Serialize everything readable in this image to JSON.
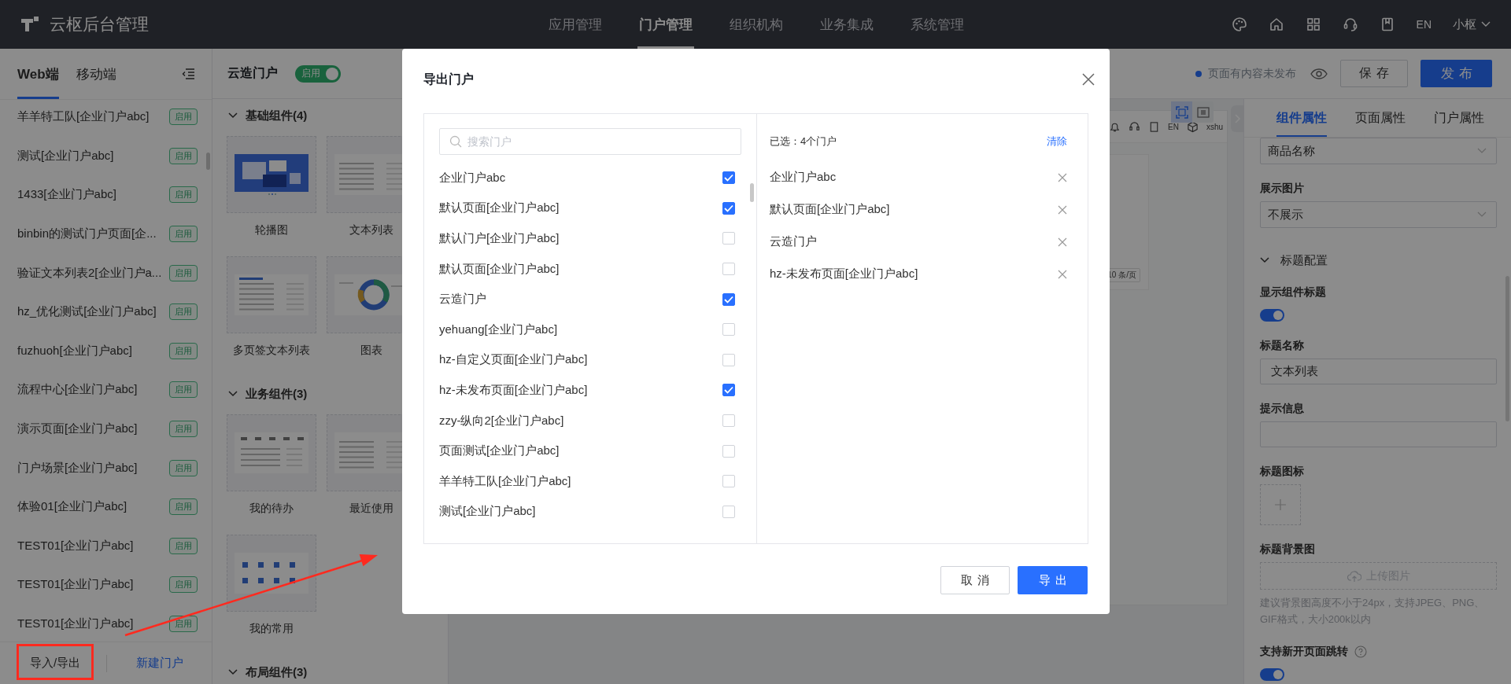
{
  "app": {
    "title": "云枢后台管理"
  },
  "nav": [
    {
      "label": "应用管理",
      "selected": false
    },
    {
      "label": "门户管理",
      "selected": true
    },
    {
      "label": "组织机构",
      "selected": false
    },
    {
      "label": "业务集成",
      "selected": false
    },
    {
      "label": "系统管理",
      "selected": false
    }
  ],
  "top_right": {
    "language": "EN",
    "user": "小枢"
  },
  "sidebar": {
    "tabs": [
      {
        "label": "Web端",
        "selected": true
      },
      {
        "label": "移动端",
        "selected": false
      }
    ],
    "items": [
      {
        "name": "羊羊特工队[企业门户abc]",
        "status": "启用"
      },
      {
        "name": "测试[企业门户abc]",
        "status": "启用"
      },
      {
        "name": "1433[企业门户abc]",
        "status": "启用"
      },
      {
        "name": "binbin的测试门户页面[企...",
        "status": "启用"
      },
      {
        "name": "验证文本列表2[企业门户a...",
        "status": "启用"
      },
      {
        "name": "hz_优化测试[企业门户abc]",
        "status": "启用"
      },
      {
        "name": "fuzhuoh[企业门户abc]",
        "status": "启用"
      },
      {
        "name": "流程中心[企业门户abc]",
        "status": "启用"
      },
      {
        "name": "演示页面[企业门户abc]",
        "status": "启用"
      },
      {
        "name": "门户场景[企业门户abc]",
        "status": "启用"
      },
      {
        "name": "体验01[企业门户abc]",
        "status": "启用"
      },
      {
        "name": "TEST01[企业门户abc]",
        "status": "启用"
      },
      {
        "name": "TEST01[企业门户abc]",
        "status": "启用"
      },
      {
        "name": "TEST01[企业门户abc]",
        "status": "启用"
      }
    ],
    "import_export": "导入/导出",
    "new_portal": "新建门户"
  },
  "portal_header": {
    "name": "云造门户",
    "enabled": true,
    "switch_label": "启用",
    "notice": "页面有内容未发布",
    "save": "保存",
    "publish": "发布"
  },
  "components": [
    {
      "title": "基础组件(4)",
      "items": [
        {
          "label": "轮播图",
          "kind": "carousel"
        },
        {
          "label": "文本列表",
          "kind": "list"
        },
        {
          "label": "多页签文本列表",
          "kind": "tabs"
        },
        {
          "label": "图表",
          "kind": "chart"
        }
      ]
    },
    {
      "title": "业务组件(3)",
      "items": [
        {
          "label": "我的待办",
          "kind": "todo"
        },
        {
          "label": "最近使用",
          "kind": "list"
        },
        {
          "label": "我的常用",
          "kind": "apps"
        }
      ]
    },
    {
      "title": "布局组件(3)"
    }
  ],
  "preview": {
    "view_modes": [
      {
        "kind": "fullscreen",
        "selected": true
      },
      {
        "kind": "columns",
        "selected": false
      }
    ],
    "language": "EN",
    "user": "xshu",
    "page_size": "10 条/页"
  },
  "properties": {
    "tabs": [
      {
        "label": "组件属性",
        "selected": true
      },
      {
        "label": "页面属性",
        "selected": false
      },
      {
        "label": "门户属性",
        "selected": false
      }
    ],
    "fields": [
      {
        "kind": "select",
        "value": "商品名称"
      },
      {
        "kind": "select",
        "label": "展示图片",
        "value": "不展示"
      },
      {
        "kind": "group",
        "label": "标题配置"
      },
      {
        "kind": "switch",
        "label": "显示组件标题",
        "on": true
      },
      {
        "kind": "input",
        "label": "标题名称",
        "value": "文本列表"
      },
      {
        "kind": "input",
        "label": "提示信息"
      },
      {
        "kind": "icon_upload",
        "label": "标题图标"
      },
      {
        "kind": "image_upload",
        "label": "标题背景图",
        "button": "上传图片",
        "hint": "建议背景图高度不小于24px，支持JPEG、PNG、GIF格式，大小200k以内"
      },
      {
        "kind": "switch",
        "label": "支持新开页面跳转",
        "help": true,
        "on": true
      }
    ]
  },
  "modal": {
    "title": "导出门户",
    "search_placeholder": "搜索门户",
    "portals": [
      {
        "name": "企业门户abc",
        "checked": true
      },
      {
        "name": "默认页面[企业门户abc]",
        "checked": true
      },
      {
        "name": "默认门户[企业门户abc]",
        "checked": false
      },
      {
        "name": "默认页面[企业门户abc]",
        "checked": false
      },
      {
        "name": "云造门户",
        "checked": true
      },
      {
        "name": "yehuang[企业门户abc]",
        "checked": false
      },
      {
        "name": "hz-自定义页面[企业门户abc]",
        "checked": false
      },
      {
        "name": "hz-未发布页面[企业门户abc]",
        "checked": true
      },
      {
        "name": "zzy-纵向2[企业门户abc]",
        "checked": false
      },
      {
        "name": "页面测试[企业门户abc]",
        "checked": false
      },
      {
        "name": "羊羊特工队[企业门户abc]",
        "checked": false
      },
      {
        "name": "测试[企业门户abc]",
        "checked": false
      }
    ],
    "summary": "已选：4个门户",
    "clear": "清除",
    "chosen": [
      "企业门户abc",
      "默认页面[企业门户abc]",
      "云造门户",
      "hz-未发布页面[企业门户abc]"
    ],
    "cancel": "取消",
    "confirm": "导出"
  }
}
